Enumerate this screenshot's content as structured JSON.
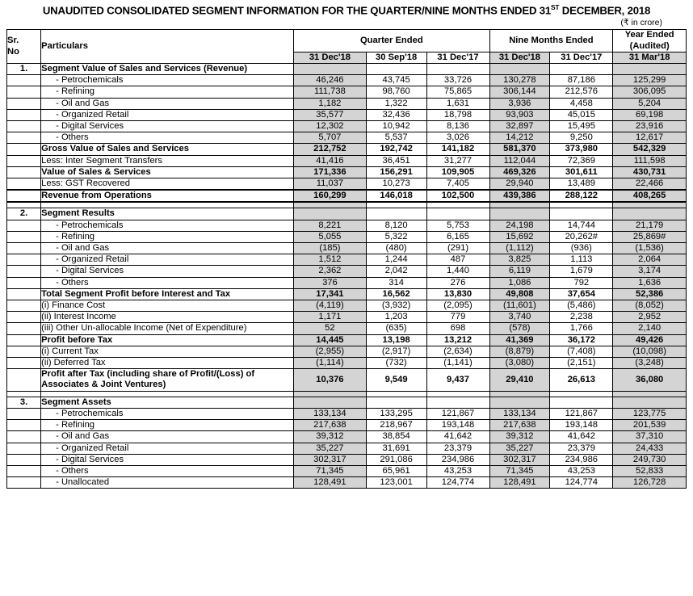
{
  "document": {
    "title_part1": "UNAUDITED CONSOLIDATED SEGMENT INFORMATION FOR THE QUARTER/NINE MONTHS ENDED 31",
    "title_sup": "ST",
    "title_part2": " DECEMBER, 2018",
    "units_note": "(₹ in crore)"
  },
  "table": {
    "header": {
      "sr_line1": "Sr.",
      "sr_line2": "No",
      "particulars": "Particulars",
      "group_quarter": "Quarter Ended",
      "group_nine_months": "Nine Months Ended",
      "group_year_line1": "Year Ended",
      "group_year_line2": "(Audited)",
      "dates": [
        "31 Dec'18",
        "30 Sep'18",
        "31 Dec'17",
        "31 Dec'18",
        "31 Dec'17",
        "31 Mar'18"
      ]
    },
    "shaded_columns": [
      0,
      3,
      5
    ],
    "shade_color": "#d4d4d4",
    "sections": [
      {
        "sr": "1.",
        "rows": [
          {
            "label": "Segment Value of Sales and Services (Revenue)",
            "bold": true,
            "values": [
              "",
              "",
              "",
              "",
              "",
              ""
            ]
          },
          {
            "label": "-  Petrochemicals",
            "indent": true,
            "values": [
              "46,246",
              "43,745",
              "33,726",
              "130,278",
              "87,186",
              "125,299"
            ]
          },
          {
            "label": "-  Refining",
            "indent": true,
            "values": [
              "111,738",
              "98,760",
              "75,865",
              "306,144",
              "212,576",
              "306,095"
            ]
          },
          {
            "label": "-  Oil and Gas",
            "indent": true,
            "values": [
              "1,182",
              "1,322",
              "1,631",
              "3,936",
              "4,458",
              "5,204"
            ]
          },
          {
            "label": "-  Organized Retail",
            "indent": true,
            "values": [
              "35,577",
              "32,436",
              "18,798",
              "93,903",
              "45,015",
              "69,198"
            ]
          },
          {
            "label": "-  Digital Services",
            "indent": true,
            "values": [
              "12,302",
              "10,942",
              "8,136",
              "32,897",
              "15,495",
              "23,916"
            ]
          },
          {
            "label": "-  Others",
            "indent": true,
            "values": [
              "5,707",
              "5,537",
              "3,026",
              "14,212",
              "9,250",
              "12,617"
            ]
          },
          {
            "label": "Gross Value of Sales and Services",
            "bold": true,
            "rule": "thin",
            "values": [
              "212,752",
              "192,742",
              "141,182",
              "581,370",
              "373,980",
              "542,329"
            ]
          },
          {
            "label": "Less: Inter Segment Transfers",
            "values": [
              "41,416",
              "36,451",
              "31,277",
              "112,044",
              "72,369",
              "111,598"
            ]
          },
          {
            "label": "Value of Sales & Services",
            "bold": true,
            "rule": "thin",
            "values": [
              "171,336",
              "156,291",
              "109,905",
              "469,326",
              "301,611",
              "430,731"
            ]
          },
          {
            "label": "Less: GST Recovered",
            "values": [
              "11,037",
              "10,273",
              "7,405",
              "29,940",
              "13,489",
              "22,466"
            ]
          },
          {
            "label": "Revenue from Operations",
            "bold": true,
            "rule": "thick",
            "values": [
              "160,299",
              "146,018",
              "102,500",
              "439,386",
              "288,122",
              "408,265"
            ]
          }
        ]
      },
      {
        "sr": "2.",
        "rows": [
          {
            "label": "Segment Results",
            "bold": true,
            "values": [
              "",
              "",
              "",
              "",
              "",
              ""
            ]
          },
          {
            "label": "-  Petrochemicals",
            "indent": true,
            "values": [
              "8,221",
              "8,120",
              "5,753",
              "24,198",
              "14,744",
              "21,179"
            ]
          },
          {
            "label": "-  Refining",
            "indent": true,
            "values": [
              "5,055",
              "5,322",
              "6,165",
              "15,692",
              "20,262#",
              "25,869#"
            ]
          },
          {
            "label": "-  Oil and Gas",
            "indent": true,
            "values": [
              "(185)",
              "(480)",
              "(291)",
              "(1,112)",
              "(936)",
              "(1,536)"
            ]
          },
          {
            "label": "-  Organized Retail",
            "indent": true,
            "values": [
              "1,512",
              "1,244",
              "487",
              "3,825",
              "1,113",
              "2,064"
            ]
          },
          {
            "label": "-  Digital Services",
            "indent": true,
            "values": [
              "2,362",
              "2,042",
              "1,440",
              "6,119",
              "1,679",
              "3,174"
            ]
          },
          {
            "label": "-  Others",
            "indent": true,
            "values": [
              "376",
              "314",
              "276",
              "1,086",
              "792",
              "1,636"
            ]
          },
          {
            "label": "Total Segment Profit before Interest and Tax",
            "bold": true,
            "rule": "thin",
            "values": [
              "17,341",
              "16,562",
              "13,830",
              "49,808",
              "37,654",
              "52,386"
            ]
          },
          {
            "label": "(i)     Finance Cost",
            "values": [
              "(4,119)",
              "(3,932)",
              "(2,095)",
              "(11,601)",
              "(5,486)",
              "(8,052)"
            ]
          },
          {
            "label": "(ii)    Interest Income",
            "values": [
              "1,171",
              "1,203",
              "779",
              "3,740",
              "2,238",
              "2,952"
            ]
          },
          {
            "label": "(iii)  Other Un-allocable  Income (Net of Expenditure)",
            "values": [
              "52",
              "(635)",
              "698",
              "(578)",
              "1,766",
              "2,140"
            ]
          },
          {
            "label": "Profit before Tax",
            "bold": true,
            "rule": "thin",
            "values": [
              "14,445",
              "13,198",
              "13,212",
              "41,369",
              "36,172",
              "49,426"
            ]
          },
          {
            "label": "(i)  Current Tax",
            "values": [
              "(2,955)",
              "(2,917)",
              "(2,634)",
              "(8,879)",
              "(7,408)",
              "(10,098)"
            ]
          },
          {
            "label": "(ii) Deferred Tax",
            "values": [
              "(1,114)",
              "(732)",
              "(1,141)",
              "(3,080)",
              "(2,151)",
              "(3,248)"
            ]
          },
          {
            "label": "Profit after Tax (including share of Profit/(Loss) of Associates & Joint Ventures)",
            "bold": true,
            "rule": "thin",
            "twoline": true,
            "values": [
              "10,376",
              "9,549",
              "9,437",
              "29,410",
              "26,613",
              "36,080"
            ]
          }
        ]
      },
      {
        "sr": "3.",
        "rows": [
          {
            "label": "Segment Assets",
            "bold": true,
            "values": [
              "",
              "",
              "",
              "",
              "",
              ""
            ]
          },
          {
            "label": "-  Petrochemicals",
            "indent": true,
            "values": [
              "133,134",
              "133,295",
              "121,867",
              "133,134",
              "121,867",
              "123,775"
            ]
          },
          {
            "label": "-  Refining",
            "indent": true,
            "values": [
              "217,638",
              "218,967",
              "193,148",
              "217,638",
              "193,148",
              "201,539"
            ]
          },
          {
            "label": "-  Oil and Gas",
            "indent": true,
            "values": [
              "39,312",
              "38,854",
              "41,642",
              "39,312",
              "41,642",
              "37,310"
            ]
          },
          {
            "label": "-  Organized Retail",
            "indent": true,
            "values": [
              "35,227",
              "31,691",
              "23,379",
              "35,227",
              "23,379",
              "24,433"
            ]
          },
          {
            "label": "-  Digital Services",
            "indent": true,
            "values": [
              "302,317",
              "291,086",
              "234,986",
              "302,317",
              "234,986",
              "249,730"
            ]
          },
          {
            "label": "-  Others",
            "indent": true,
            "values": [
              "71,345",
              "65,961",
              "43,253",
              "71,345",
              "43,253",
              "52,833"
            ]
          },
          {
            "label": "-  Unallocated",
            "indent": true,
            "values": [
              "128,491",
              "123,001",
              "124,774",
              "128,491",
              "124,774",
              "126,728"
            ]
          }
        ]
      }
    ]
  }
}
